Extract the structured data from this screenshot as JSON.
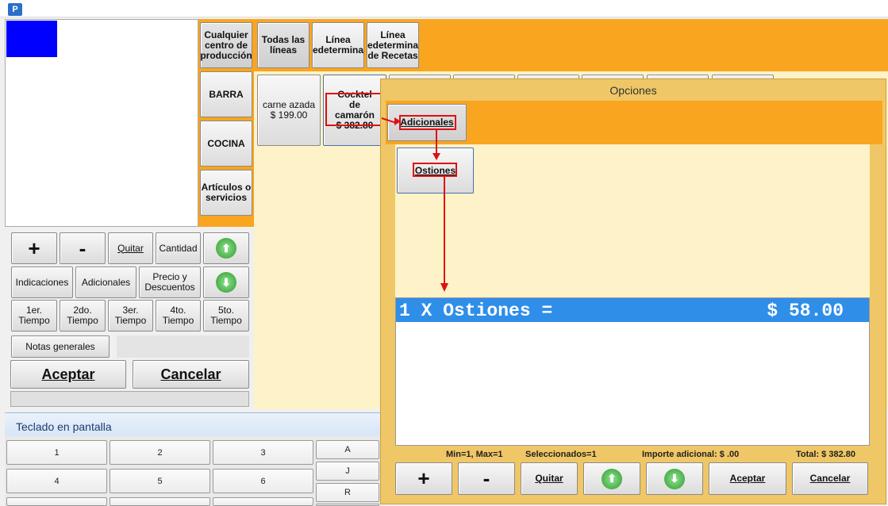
{
  "window": {
    "app_icon": "app-icon"
  },
  "categories": {
    "production": "Cualquier centro de producción",
    "all_lines": "Todas las líneas",
    "line_predetermined": "Línea edetermina",
    "line_recipes": "Línea edetermina de Recetas",
    "barra": "BARRA",
    "cocina": "COCINA",
    "articulos": "Artículos o servicios"
  },
  "products": [
    {
      "name": "carne azada",
      "price": "$ 199.00"
    },
    {
      "name": "Cocktel de camarón",
      "price": "$ 382.80"
    }
  ],
  "order_panel": {
    "plus": "+",
    "minus": "-",
    "quitar": "Quitar",
    "cantidad": "Cantidad",
    "indicaciones": "Indicaciones",
    "adicionales": "Adicionales",
    "precio": "Precio y Descuentos",
    "t1": "1er. Tiempo",
    "t2": "2do. Tiempo",
    "t3": "3er. Tiempo",
    "t4": "4to. Tiempo",
    "t5": "5to. Tiempo",
    "notas": "Notas generales",
    "aceptar": "Aceptar",
    "cancelar": "Cancelar"
  },
  "keyboard": {
    "title": "Teclado en pantalla",
    "keys": [
      "1",
      "2",
      "3",
      "4",
      "5",
      "6"
    ],
    "letters": [
      "A",
      "J",
      "R"
    ]
  },
  "dialog": {
    "title": "Opciones",
    "group": "Adicionales",
    "option": "Ostiones",
    "selected_line_left": "1 X Ostiones =",
    "selected_line_right": "$ 58.00",
    "minmax": "Min=1, Max=1",
    "seleccionados": "Seleccionados=1",
    "importe": "Importe adicional: $ .00",
    "total": "Total: $ 382.80",
    "plus": "+",
    "minus": "-",
    "quitar": "Quitar",
    "aceptar": "Aceptar",
    "cancelar": "Cancelar"
  },
  "colors": {
    "orange": "#f9a51f",
    "cream": "#fdf2c8",
    "selection": "#2f8ee8",
    "red": "#e01010"
  }
}
